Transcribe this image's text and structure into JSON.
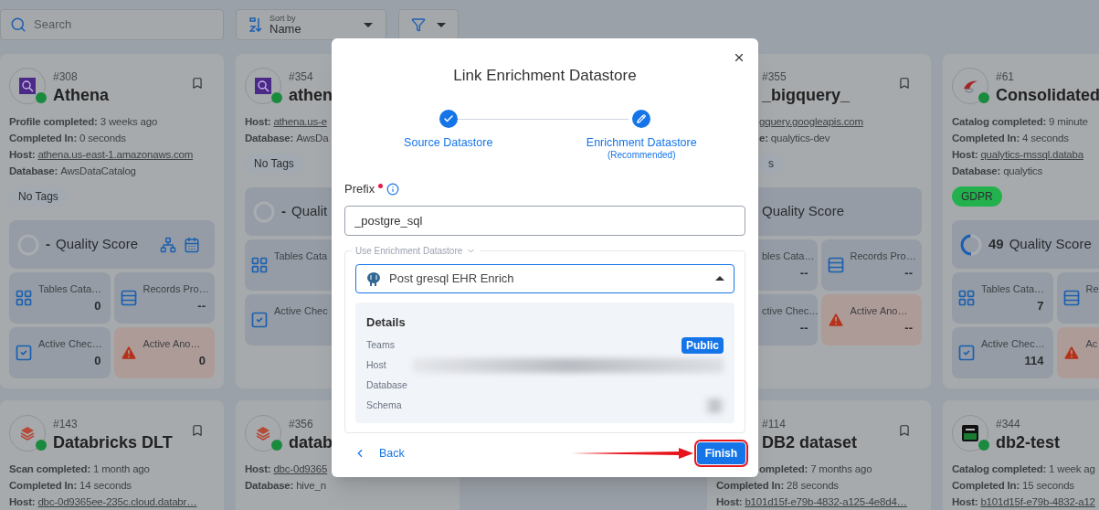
{
  "toolbar": {
    "search": {
      "placeholder": "Search"
    },
    "sort": {
      "label": "Sort by",
      "value": "Name"
    }
  },
  "rows": [
    [
      {
        "id": "#308",
        "name": "Athena",
        "kind": "athena",
        "online": true,
        "fields": [
          {
            "label": "Profile completed:",
            "value": "3 weeks ago"
          },
          {
            "label": "Completed In:",
            "value": "0 seconds"
          },
          {
            "label": "Host:",
            "value": "athena.us-east-1.amazonaws.com",
            "link": true
          },
          {
            "label": "Database:",
            "value": "AwsDataCatalog"
          }
        ],
        "tags": [
          {
            "label": "No Tags",
            "color": "#a3a9b1"
          }
        ],
        "quality": {
          "score": "-",
          "label": "Quality Score",
          "tools": true
        },
        "stats": [
          {
            "kind": "tables",
            "label": "Tables Cata…",
            "value": "0"
          },
          {
            "kind": "records",
            "label": "Records Pro…",
            "value": "--"
          },
          {
            "kind": "checks",
            "label": "Active Chec…",
            "value": "0"
          },
          {
            "kind": "anomalies",
            "label": "Active Ano…",
            "value": "0"
          }
        ]
      },
      {
        "id": "#354",
        "name": "athen",
        "kind": "athena",
        "online": true,
        "fields": [
          {
            "label": "Host:",
            "value": "athena.us-e",
            "link": true
          },
          {
            "label": "Database:",
            "value": "AwsDa"
          }
        ],
        "tags": [
          {
            "label": "No Tags",
            "color": "#a3a9b1"
          }
        ],
        "quality": {
          "score": "-",
          "label": "Qualit"
        },
        "stats": [
          {
            "kind": "tables",
            "label": "Tables Cata"
          },
          {
            "kind": "checks",
            "label": "Active Chec"
          }
        ]
      },
      {
        "id": "#355",
        "name": "_bigquery_",
        "fields": [
          {
            "value": "gquery.googleapis.com",
            "link": true
          },
          {
            "label": "e:",
            "value": "qualytics-dev"
          }
        ],
        "tags": [
          {
            "label": "s",
            "color": "#a3a9b1"
          }
        ],
        "quality": {
          "label": "Quality Score"
        },
        "stats": [
          {
            "kind": "tables",
            "label": "bles Cata…",
            "value": "--"
          },
          {
            "kind": "records",
            "label": "Records Pro…",
            "value": "--"
          },
          {
            "kind": "checks",
            "label": "ctive Chec…",
            "value": "--"
          },
          {
            "kind": "anomalies",
            "label": "Active Ano…",
            "value": "--"
          }
        ]
      },
      {
        "id": "#61",
        "name": "Consolidated",
        "kind": "sqlserver",
        "online": true,
        "fields": [
          {
            "label": "Catalog completed:",
            "value": "9 minute"
          },
          {
            "label": "Completed In:",
            "value": "4 seconds"
          },
          {
            "label": "Host:",
            "value": "qualytics-mssql.databa",
            "link": true
          },
          {
            "label": "Database:",
            "value": "qualytics"
          }
        ],
        "tags": [
          {
            "label": "GDPR",
            "color": "#22b14c"
          }
        ],
        "quality": {
          "score": "49",
          "level": 0.49,
          "label": "Quality Score"
        },
        "stats": [
          {
            "kind": "tables",
            "label": "Tables Cata…",
            "value": "7"
          },
          {
            "kind": "records",
            "label": "Re"
          },
          {
            "kind": "checks",
            "label": "Active Chec…",
            "value": "114"
          },
          {
            "kind": "anomalies",
            "label": "Ac"
          }
        ]
      }
    ],
    [
      {
        "id": "#143",
        "name": "Databricks DLT",
        "kind": "databricks",
        "online": true,
        "fields": [
          {
            "label": "Scan completed:",
            "value": "1 month ago"
          },
          {
            "label": "Completed In:",
            "value": "14 seconds"
          },
          {
            "label": "Host:",
            "value": "dbc-0d9365ee-235c.cloud.databr…",
            "link": true
          }
        ]
      },
      {
        "id": "#356",
        "name": "datab",
        "kind": "databricks",
        "online": true,
        "fields": [
          {
            "label": "Host:",
            "value": "dbc-0d9365",
            "link": true
          },
          {
            "label": "Database:",
            "value": "hive_n"
          }
        ]
      },
      {
        "id": "#114",
        "name": "DB2 dataset",
        "fields": [
          {
            "label": "ompleted:",
            "value": "7 months ago"
          },
          {
            "label": "Completed In:",
            "value": "28 seconds"
          },
          {
            "label": "Host:",
            "value": "b101d15f-e79b-4832-a125-4e8d4…",
            "link": true
          }
        ]
      },
      {
        "id": "#344",
        "name": "db2-test",
        "kind": "db2",
        "online": true,
        "fields": [
          {
            "label": "Catalog completed:",
            "value": "1 week ag"
          },
          {
            "label": "Completed In:",
            "value": "15 seconds"
          },
          {
            "label": "Host:",
            "value": "b101d15f-e79b-4832-a12",
            "link": true
          }
        ]
      }
    ]
  ],
  "modal": {
    "title": "Link Enrichment Datastore",
    "steps": [
      {
        "label": "Source Datastore",
        "done": true
      },
      {
        "label": "Enrichment Datastore",
        "note": "(Recommended)",
        "done": false
      }
    ],
    "prefix": {
      "label": "Prefix",
      "required": true,
      "value": "_postgre_sql"
    },
    "datastore": {
      "legend": "Use Enrichment Datastore",
      "value": "Post gresql EHR Enrich",
      "expanded": true
    },
    "details": {
      "title": "Details",
      "rows": [
        {
          "label": "Teams",
          "badge": "Public"
        },
        {
          "label": "Host",
          "redacted": true
        },
        {
          "label": "Database"
        },
        {
          "label": "Schema",
          "redacted": true
        }
      ]
    },
    "back": "Back",
    "finish": "Finish",
    "highlight": true
  }
}
